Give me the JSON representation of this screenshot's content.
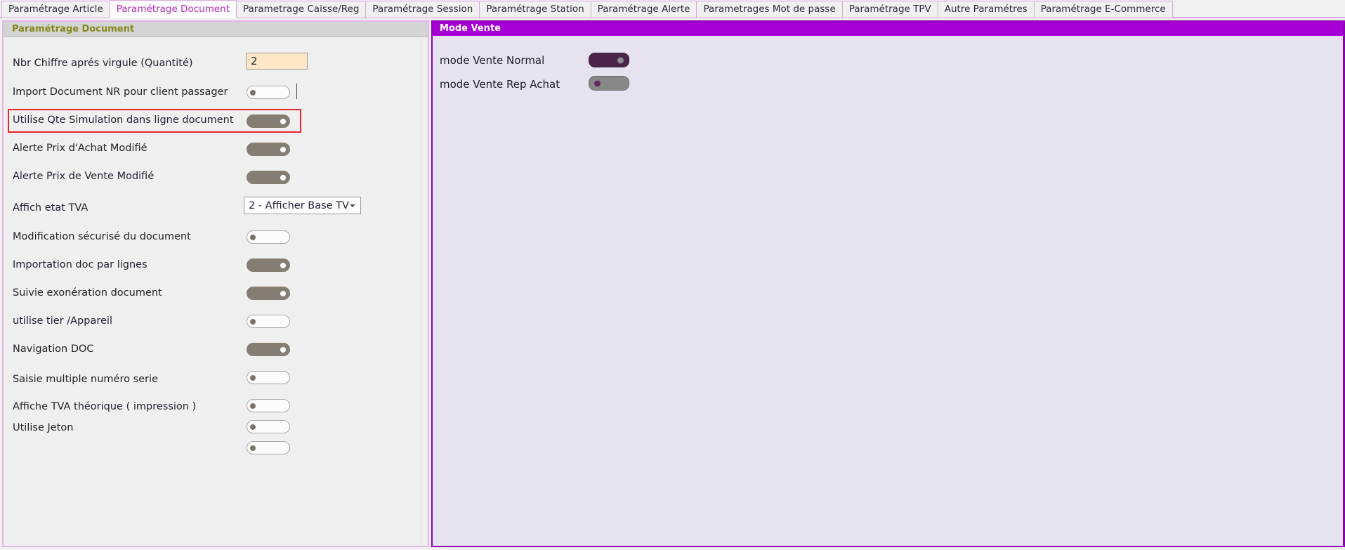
{
  "tabs": [
    {
      "label": "Paramétrage Article",
      "active": false
    },
    {
      "label": "Paramétrage Document",
      "active": true
    },
    {
      "label": "Parametrage Caisse/Reg",
      "active": false
    },
    {
      "label": "Paramétrage Session",
      "active": false
    },
    {
      "label": "Paramétrage Station",
      "active": false
    },
    {
      "label": "Paramétrage Alerte",
      "active": false
    },
    {
      "label": "Parametrages Mot de passe",
      "active": false
    },
    {
      "label": "Paramétrage TPV",
      "active": false
    },
    {
      "label": "Autre Paramétres",
      "active": false
    },
    {
      "label": "Paramétrage E-Commerce",
      "active": false
    }
  ],
  "left_panel": {
    "header": "Paramétrage Document",
    "rows": [
      {
        "label": "Nbr Chiffre aprés virgule (Quantité)",
        "control": "textbox",
        "value": "2"
      },
      {
        "label": "Import Document NR pour client passager",
        "control": "toggle",
        "state": "off"
      },
      {
        "label": "Utilise Qte Simulation dans ligne document",
        "control": "toggle",
        "state": "on",
        "highlighted": true
      },
      {
        "label": "Alerte Prix d'Achat Modifié",
        "control": "toggle",
        "state": "on"
      },
      {
        "label": "Alerte Prix de Vente Modifié",
        "control": "toggle",
        "state": "on"
      },
      {
        "label": "Affich etat TVA",
        "control": "select",
        "value": "2 - Afficher Base TV"
      },
      {
        "label": "Modification sécurisé du document",
        "control": "toggle",
        "state": "off"
      },
      {
        "label": "Importation doc par lignes",
        "control": "toggle",
        "state": "on"
      },
      {
        "label": "Suivie exonération document",
        "control": "toggle",
        "state": "on"
      },
      {
        "label": "utilise tier /Appareil",
        "control": "toggle",
        "state": "off"
      },
      {
        "label": "Navigation DOC",
        "control": "toggle",
        "state": "on"
      },
      {
        "label": "Saisie multiple numéro serie",
        "control": "toggle",
        "state": "off"
      },
      {
        "label": "Affiche TVA théorique ( impression )",
        "control": "toggle",
        "state": "off"
      },
      {
        "label": "Utilise Jeton",
        "control": "toggle",
        "state": "off"
      },
      {
        "label": "",
        "control": "toggle",
        "state": "off"
      }
    ]
  },
  "right_panel": {
    "header": "Mode Vente",
    "rows": [
      {
        "label": "mode Vente Normal",
        "state": "on"
      },
      {
        "label": "mode Vente Rep Achat",
        "state": "off"
      }
    ]
  },
  "colors": {
    "tab_active_text": "#b02fb0",
    "tab_border": "#dba8e0",
    "left_header_text": "#87871c",
    "right_header_bg": "#a600d6",
    "right_panel_bg": "#e6e2f0",
    "highlight": "#e8252b",
    "toggle_on": "#857d72",
    "vente_on": "#4b2449"
  }
}
